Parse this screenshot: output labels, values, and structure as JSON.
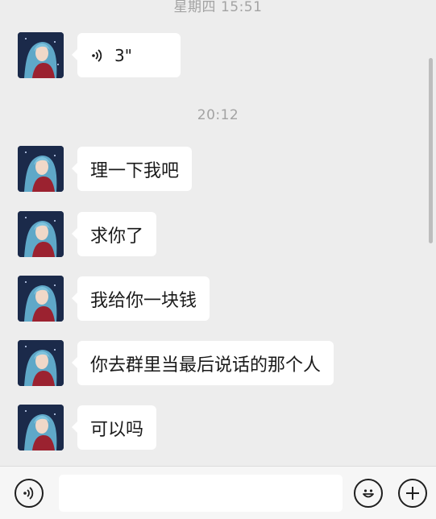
{
  "chat": {
    "timestamp_top": "星期四 15:51",
    "voice_message": {
      "duration": "3\""
    },
    "timestamp_mid": "20:12",
    "messages": [
      {
        "text": "理一下我吧"
      },
      {
        "text": "求你了"
      },
      {
        "text": "我给你一块钱"
      },
      {
        "text": "你去群里当最后说话的那个人"
      },
      {
        "text": "可以吗"
      }
    ]
  },
  "input": {
    "value": "",
    "placeholder": ""
  },
  "icons": {
    "voice_toggle": "voice-icon",
    "emoji": "emoji-icon",
    "plus": "plus-icon",
    "voice_wave": "voice-wave-icon"
  },
  "colors": {
    "background": "#ededed",
    "bubble": "#ffffff",
    "timestamp": "#a3a3a3"
  }
}
